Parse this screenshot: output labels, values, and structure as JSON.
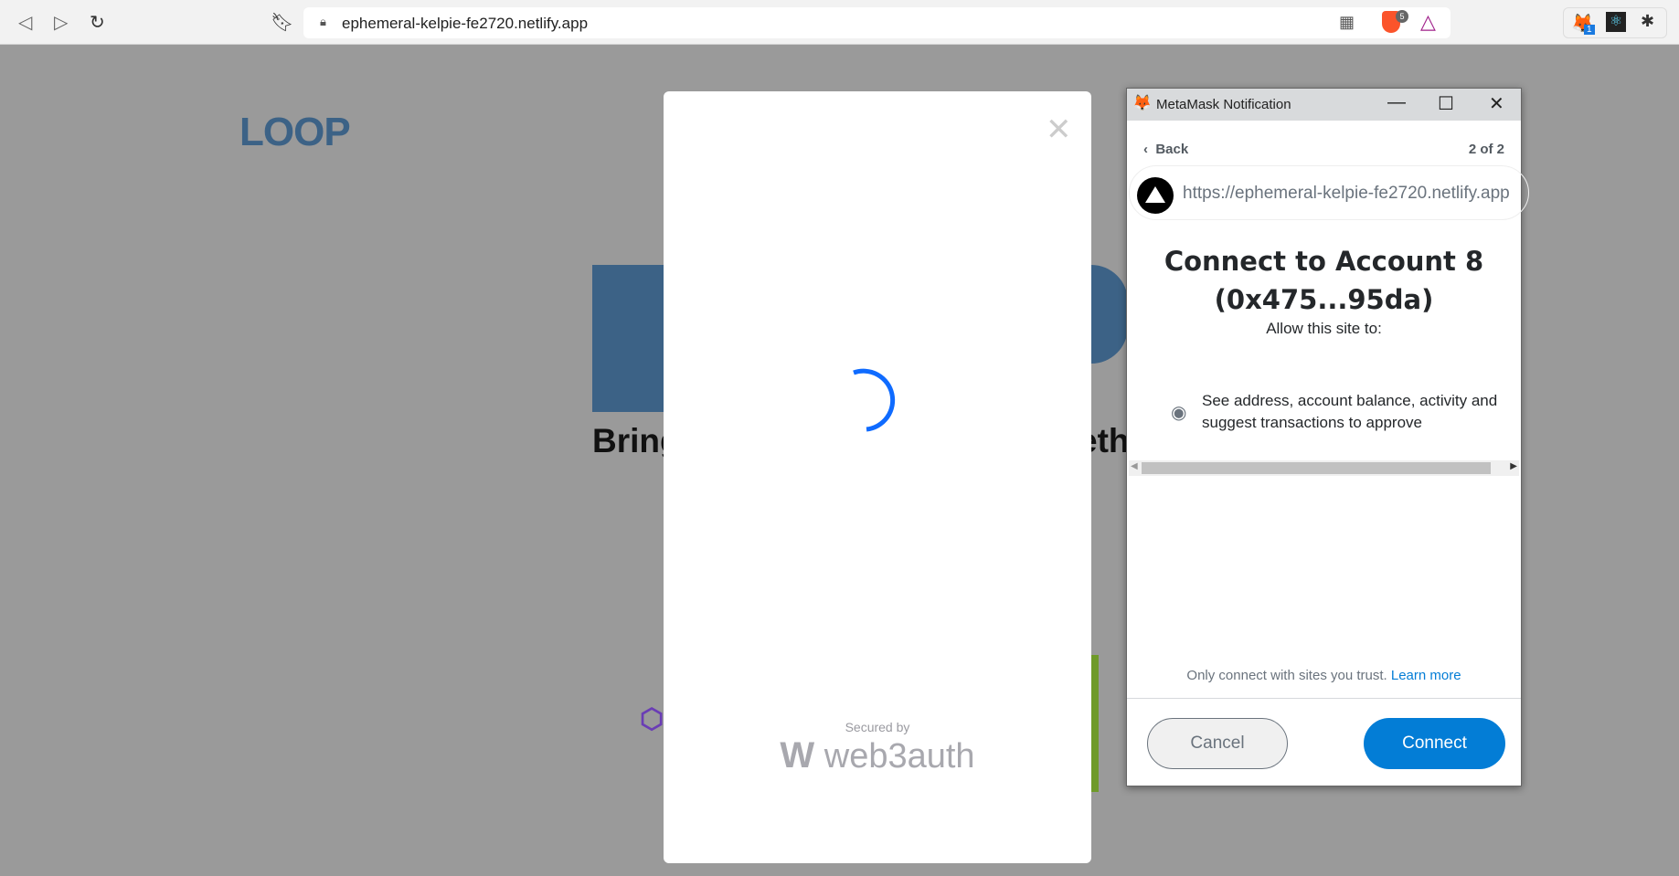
{
  "browser": {
    "url": "ephemeral-kelpie-fe2720.netlify.app",
    "brave_badge": "5",
    "metamask_badge": "1"
  },
  "page": {
    "logo": "LOOP",
    "headline_left": "Bring",
    "headline_right": "eth"
  },
  "web3auth": {
    "secured_by": "Secured by",
    "brand": "web3auth",
    "spinner_color": "#0f6bff"
  },
  "metamask": {
    "window_title": "MetaMask Notification",
    "back_label": "Back",
    "step": "2 of 2",
    "site_url": "https://ephemeral-kelpie-fe2720.netlify.app",
    "heading_line1": "Connect to Account 8",
    "heading_line2": "(0x475...95da)",
    "allow": "Allow this site to:",
    "permission": "See address, account balance, activity and suggest transactions to approve",
    "trust_text": "Only connect with sites you trust.",
    "learn_more": "Learn more",
    "cancel": "Cancel",
    "connect": "Connect",
    "accent": "#037dd6"
  }
}
